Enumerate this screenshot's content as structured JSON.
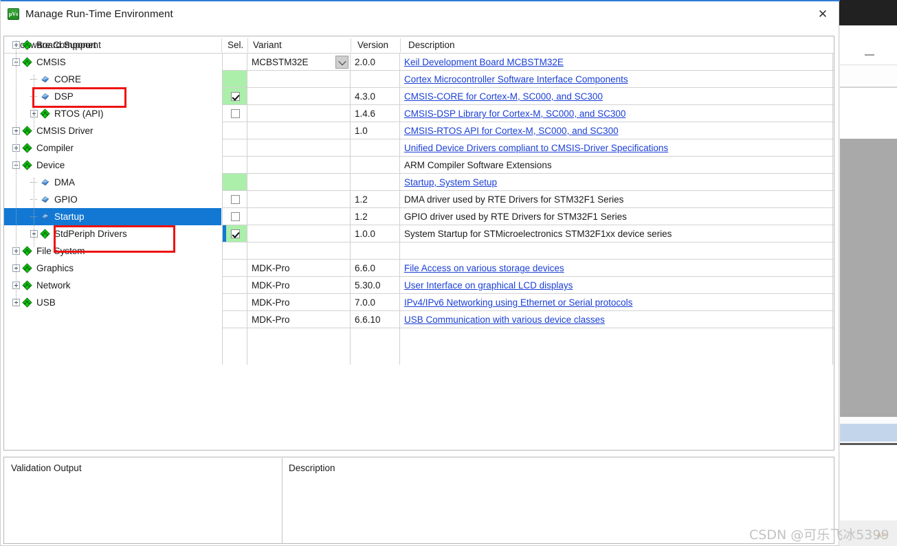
{
  "window": {
    "title": "Manage Run-Time Environment",
    "icon": "keil-uvision-icon",
    "close_label": "✕"
  },
  "columns": {
    "tree": "Software Component",
    "sel": "Sel.",
    "variant": "Variant",
    "version": "Version",
    "description": "Description"
  },
  "tree": [
    {
      "label": "Board Support",
      "depth": 0,
      "expander": "plus",
      "icon": "pack-icon",
      "selected": false
    },
    {
      "label": "CMSIS",
      "depth": 0,
      "expander": "minus",
      "icon": "pack-icon",
      "selected": false
    },
    {
      "label": "CORE",
      "depth": 1,
      "expander": "none",
      "icon": "component-icon",
      "selected": false
    },
    {
      "label": "DSP",
      "depth": 1,
      "expander": "none",
      "icon": "component-icon",
      "selected": false
    },
    {
      "label": "RTOS (API)",
      "depth": 1,
      "expander": "plus",
      "icon": "pack-icon",
      "selected": false
    },
    {
      "label": "CMSIS Driver",
      "depth": 0,
      "expander": "plus",
      "icon": "pack-icon",
      "selected": false
    },
    {
      "label": "Compiler",
      "depth": 0,
      "expander": "plus",
      "icon": "pack-icon",
      "selected": false
    },
    {
      "label": "Device",
      "depth": 0,
      "expander": "minus",
      "icon": "pack-icon",
      "selected": false
    },
    {
      "label": "DMA",
      "depth": 1,
      "expander": "none",
      "icon": "component-icon",
      "selected": false
    },
    {
      "label": "GPIO",
      "depth": 1,
      "expander": "none",
      "icon": "component-icon",
      "selected": false
    },
    {
      "label": "Startup",
      "depth": 1,
      "expander": "none",
      "icon": "component-icon",
      "selected": true
    },
    {
      "label": "StdPeriph Drivers",
      "depth": 1,
      "expander": "plus",
      "icon": "pack-icon",
      "selected": false
    },
    {
      "label": "File System",
      "depth": 0,
      "expander": "plus",
      "icon": "pack-icon",
      "selected": false
    },
    {
      "label": "Graphics",
      "depth": 0,
      "expander": "plus",
      "icon": "pack-icon",
      "selected": false
    },
    {
      "label": "Network",
      "depth": 0,
      "expander": "plus",
      "icon": "pack-icon",
      "selected": false
    },
    {
      "label": "USB",
      "depth": 0,
      "expander": "plus",
      "icon": "pack-icon",
      "selected": false
    }
  ],
  "rows": [
    {
      "sel": "none",
      "sel_bg": "white",
      "variant": "MCBSTM32E",
      "variant_combo": true,
      "version": "2.0.0",
      "description": "Keil Development Board MCBSTM32E",
      "is_link": true,
      "selected": false
    },
    {
      "sel": "none",
      "sel_bg": "green",
      "variant": "",
      "variant_combo": false,
      "version": "",
      "description": "Cortex Microcontroller Software Interface Components",
      "is_link": true,
      "selected": false
    },
    {
      "sel": "checked",
      "sel_bg": "green",
      "variant": "",
      "variant_combo": false,
      "version": "4.3.0",
      "description": "CMSIS-CORE for Cortex-M, SC000, and SC300",
      "is_link": true,
      "selected": false
    },
    {
      "sel": "unchecked",
      "sel_bg": "white",
      "variant": "",
      "variant_combo": false,
      "version": "1.4.6",
      "description": "CMSIS-DSP Library for Cortex-M, SC000, and SC300",
      "is_link": true,
      "selected": false
    },
    {
      "sel": "none",
      "sel_bg": "white",
      "variant": "",
      "variant_combo": false,
      "version": "1.0",
      "description": "CMSIS-RTOS API for Cortex-M, SC000, and SC300",
      "is_link": true,
      "selected": false
    },
    {
      "sel": "none",
      "sel_bg": "white",
      "variant": "",
      "variant_combo": false,
      "version": "",
      "description": "Unified Device Drivers compliant to CMSIS-Driver Specifications",
      "is_link": true,
      "selected": false
    },
    {
      "sel": "none",
      "sel_bg": "white",
      "variant": "",
      "variant_combo": false,
      "version": "",
      "description": "ARM Compiler Software Extensions",
      "is_link": false,
      "selected": false
    },
    {
      "sel": "none",
      "sel_bg": "green",
      "variant": "",
      "variant_combo": false,
      "version": "",
      "description": "Startup, System Setup",
      "is_link": true,
      "selected": false
    },
    {
      "sel": "unchecked",
      "sel_bg": "white",
      "variant": "",
      "variant_combo": false,
      "version": "1.2",
      "description": "DMA driver used by RTE Drivers for STM32F1 Series",
      "is_link": false,
      "selected": false
    },
    {
      "sel": "unchecked",
      "sel_bg": "white",
      "variant": "",
      "variant_combo": false,
      "version": "1.2",
      "description": "GPIO driver used by RTE Drivers for STM32F1 Series",
      "is_link": false,
      "selected": false
    },
    {
      "sel": "checked",
      "sel_bg": "green",
      "variant": "",
      "variant_combo": false,
      "version": "1.0.0",
      "description": "System Startup for STMicroelectronics STM32F1xx device series",
      "is_link": false,
      "selected": true
    },
    {
      "sel": "none",
      "sel_bg": "white",
      "variant": "",
      "variant_combo": false,
      "version": "",
      "description": "",
      "is_link": false,
      "selected": false
    },
    {
      "sel": "none",
      "sel_bg": "white",
      "variant": "MDK-Pro",
      "variant_combo": false,
      "version": "6.6.0",
      "description": "File Access on various storage devices",
      "is_link": true,
      "selected": false
    },
    {
      "sel": "none",
      "sel_bg": "white",
      "variant": "MDK-Pro",
      "variant_combo": false,
      "version": "5.30.0",
      "description": "User Interface on graphical LCD displays",
      "is_link": true,
      "selected": false
    },
    {
      "sel": "none",
      "sel_bg": "white",
      "variant": "MDK-Pro",
      "variant_combo": false,
      "version": "7.0.0",
      "description": "IPv4/IPv6 Networking using Ethernet or Serial protocols",
      "is_link": true,
      "selected": false
    },
    {
      "sel": "none",
      "sel_bg": "white",
      "variant": "MDK-Pro",
      "variant_combo": false,
      "version": "6.6.10",
      "description": "USB Communication with various device classes",
      "is_link": true,
      "selected": false
    }
  ],
  "bottom": {
    "validation_output_title": "Validation Output",
    "description_title": "Description"
  },
  "annotations": [
    {
      "name": "core-highlight",
      "label": "red box around CORE row"
    },
    {
      "name": "startup-highlight",
      "label": "red box around Startup row"
    }
  ],
  "watermark": {
    "text": "CSDN @可乐飞冰5399",
    "sub": "AP"
  },
  "colors": {
    "accent": "#2e7cd6",
    "selection": "#1278d4",
    "selected_cell_green": "#abefab",
    "link": "#1a3fd6",
    "annotation_red": "#ee1111"
  }
}
